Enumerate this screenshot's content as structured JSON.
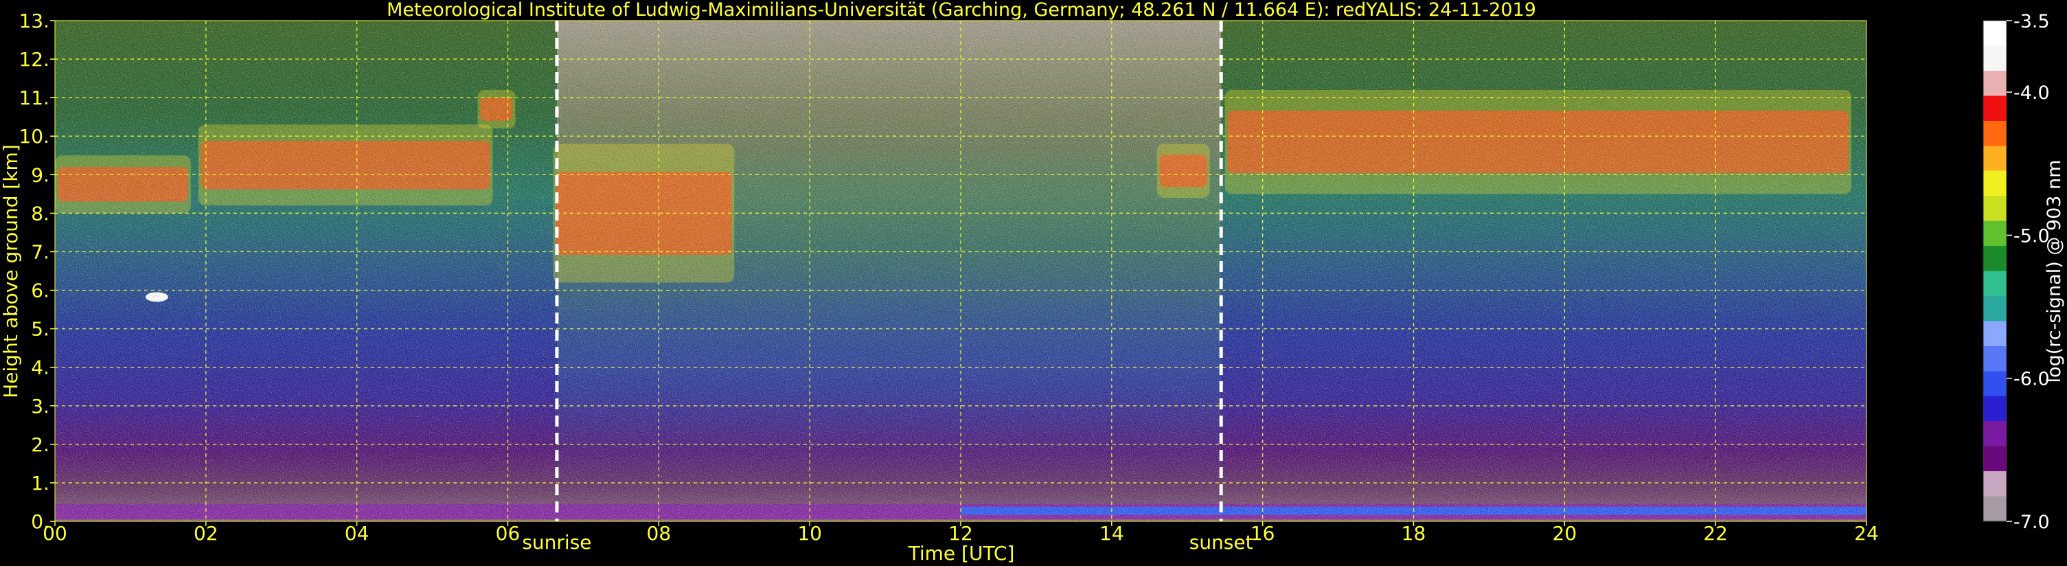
{
  "chart_data": {
    "type": "heatmap",
    "title": "Meteorological Institute of Ludwig-Maximilians-Universität (Garching, Germany; 48.261 N / 11.664 E):    redYALIS: 24-11-2019",
    "xlabel": "Time [UTC]",
    "ylabel": "Height above ground [km]",
    "x_ticks": [
      "00",
      "02",
      "04",
      "06",
      "08",
      "10",
      "12",
      "14",
      "16",
      "18",
      "20",
      "22",
      "24"
    ],
    "y_ticks": [
      "0.",
      "1.",
      "2.",
      "3.",
      "4.",
      "5.",
      "6.",
      "7.",
      "8.",
      "9.",
      "10.",
      "11.",
      "12.",
      "13."
    ],
    "xlim": [
      0,
      24
    ],
    "ylim": [
      0,
      13
    ],
    "grid": true,
    "colorbar": {
      "label": "log(rc-signal) @ 903 nm",
      "ticks": [
        "-3.5",
        "-4.0",
        "-5.0",
        "-6.0",
        "-7.0"
      ],
      "tick_values": [
        -3.5,
        -4.0,
        -5.0,
        -6.0,
        -7.0
      ],
      "range": [
        -7.0,
        -3.5
      ],
      "colors": [
        "#a79aa5",
        "#c8a8c0",
        "#6a0a7a",
        "#7a1aa0",
        "#2a20d0",
        "#3050f0",
        "#5878f5",
        "#8aa8ff",
        "#2aa8a0",
        "#30c090",
        "#1a8a2a",
        "#60c030",
        "#c8e020",
        "#f0f020",
        "#ffb020",
        "#ff6a10",
        "#f01010",
        "#e8b0b0",
        "#f6f6f6",
        "#ffffff"
      ]
    },
    "events": [
      {
        "label": "sunrise",
        "time": 6.65
      },
      {
        "label": "sunset",
        "time": 15.45
      }
    ],
    "features": [
      {
        "kind": "cirrus",
        "start": 0.0,
        "end": 1.8,
        "base_km": 8.0,
        "top_km": 9.5
      },
      {
        "kind": "cirrus",
        "start": 1.9,
        "end": 5.8,
        "base_km": 8.2,
        "top_km": 10.3
      },
      {
        "kind": "cirrus",
        "start": 5.6,
        "end": 6.1,
        "base_km": 10.2,
        "top_km": 11.2
      },
      {
        "kind": "cirrus",
        "start": 6.6,
        "end": 9.0,
        "base_km": 6.2,
        "top_km": 9.8
      },
      {
        "kind": "cirrus",
        "start": 14.6,
        "end": 15.3,
        "base_km": 8.4,
        "top_km": 9.8
      },
      {
        "kind": "cirrus",
        "start": 15.5,
        "end": 23.8,
        "base_km": 8.5,
        "top_km": 11.2
      },
      {
        "kind": "blob",
        "start": 1.2,
        "end": 1.5,
        "base_km": 5.7,
        "top_km": 5.95
      },
      {
        "kind": "boundary_layer",
        "start": 0.0,
        "end": 24.0,
        "base_km": 0.05,
        "top_km": 0.45
      }
    ]
  }
}
